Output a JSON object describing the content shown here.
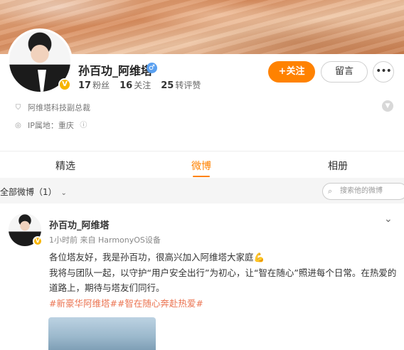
{
  "profile": {
    "name": "孙百功_阿维塔",
    "gender_symbol": "♂",
    "verified_badge": "V",
    "stats": [
      {
        "num": "17",
        "label": "粉丝"
      },
      {
        "num": "16",
        "label": "关注"
      },
      {
        "num": "25",
        "label": "转评赞"
      }
    ],
    "follow_label": "+关注",
    "message_label": "留言",
    "more_label": "•••",
    "title": "阿维塔科技副总裁",
    "ip_location": "IP属地：重庆",
    "info_icon": "ⓘ"
  },
  "tabs": {
    "items": [
      {
        "label": "精选"
      },
      {
        "label": "微博"
      },
      {
        "label": "相册"
      }
    ],
    "active": "微博"
  },
  "filter": {
    "label": "全部微博（1）",
    "search_placeholder": "搜索他的微博"
  },
  "post": {
    "author": "孙百功_阿维塔",
    "time": "1小时前",
    "source": "来自 HarmonyOS设备",
    "line1": "各位塔友好，我是孙百功，很高兴加入阿维塔大家庭💪",
    "line2": "我将与团队一起，以守护“用户安全出行”为初心，让“智在随心”照进每个日常。在热爱的道路上，期待与塔友们同行。",
    "topics": "#新豪华阿维塔##智在随心奔赴热爱#"
  },
  "colors": {
    "accent": "#ff8200",
    "topic": "#eb7350",
    "verified": "#f7b500"
  }
}
